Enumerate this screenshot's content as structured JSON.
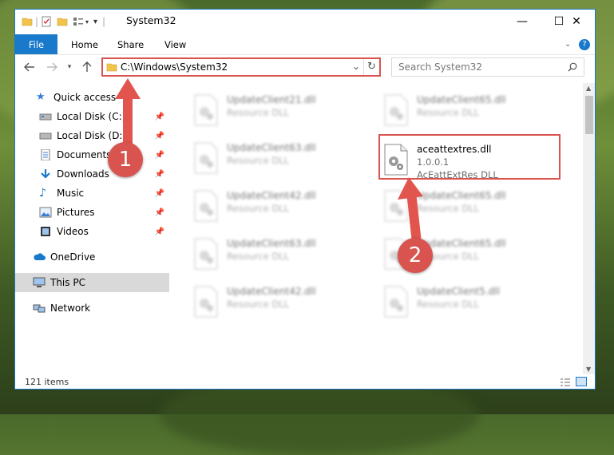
{
  "window": {
    "title": "System32",
    "accent": "#1979ca",
    "minimize_glyph": "—",
    "maximize_glyph": "☐",
    "close_glyph": "✕"
  },
  "ribbon": {
    "tabs": [
      "File",
      "Home",
      "Share",
      "View"
    ]
  },
  "address": {
    "path": "C:\\Windows\\System32"
  },
  "search": {
    "placeholder": "Search System32"
  },
  "navpane": {
    "quick_access": "Quick access",
    "items": [
      {
        "label": "Local Disk (C:)",
        "icon": "drive-icon"
      },
      {
        "label": "Local Disk (D:)",
        "icon": "drive-icon"
      },
      {
        "label": "Documents",
        "icon": "documents-icon"
      },
      {
        "label": "Downloads",
        "icon": "downloads-icon"
      },
      {
        "label": "Music",
        "icon": "music-icon"
      },
      {
        "label": "Pictures",
        "icon": "pictures-icon"
      },
      {
        "label": "Videos",
        "icon": "videos-icon"
      }
    ],
    "onedrive": "OneDrive",
    "this_pc": "This PC",
    "network": "Network"
  },
  "files": {
    "left": [
      {
        "name": "UpdateClient21.dll",
        "type": "Resource DLL"
      },
      {
        "name": "UpdateClient63.dll",
        "type": "Resource DLL"
      },
      {
        "name": "UpdateClient42.dll",
        "type": "Resource DLL"
      },
      {
        "name": "UpdateClient63.dll",
        "type": "Resource DLL"
      },
      {
        "name": "UpdateClient42.dll",
        "type": "Resource DLL"
      }
    ],
    "right": [
      {
        "name": "UpdateClient65.dll",
        "type": "Resource DLL"
      },
      {
        "name": "UpdateClient65.dll",
        "type": "Resource DLL"
      },
      {
        "name": "UpdateClient65.dll",
        "type": "Resource DLL"
      },
      {
        "name": "UpdateClient5.dll",
        "type": "Resource DLL"
      }
    ],
    "highlight": {
      "name": "aceattextres.dll",
      "version": "1.0.0.1",
      "description": "AcEattExtRes DLL"
    }
  },
  "status": {
    "count": "121 items"
  },
  "callouts": {
    "one": "1",
    "two": "2",
    "color": "#d9534f"
  }
}
